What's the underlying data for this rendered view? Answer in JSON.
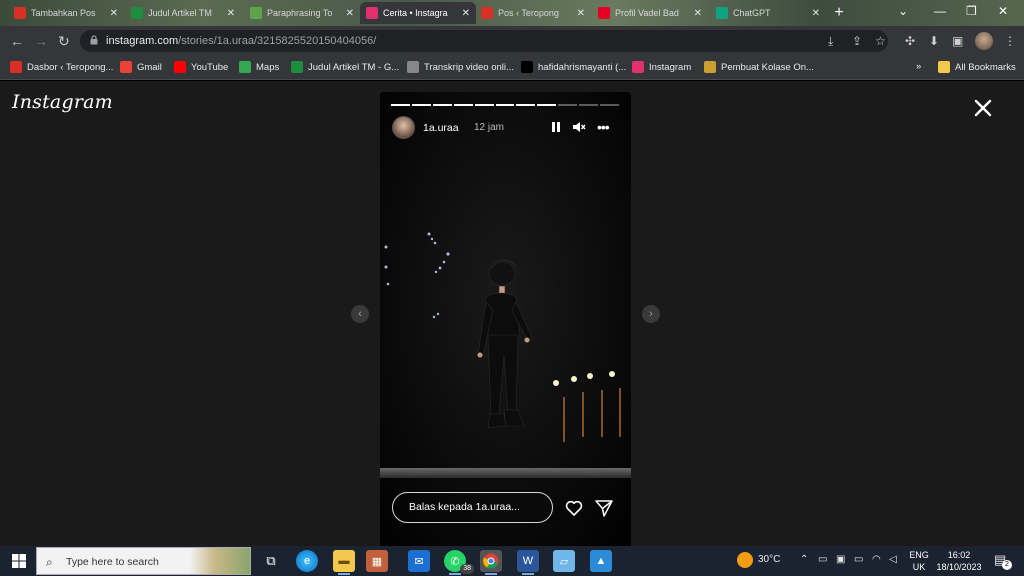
{
  "browser": {
    "tabs": [
      {
        "title": "Tambahkan Pos",
        "favicon": "blogger-m-icon",
        "color": "#d93025"
      },
      {
        "title": "Judul Artikel TM",
        "favicon": "sheets-plus-icon",
        "color": "#1e8e3e"
      },
      {
        "title": "Paraphrasing To",
        "favicon": "quillbot-icon",
        "color": "#5ba44a"
      },
      {
        "title": "Cerita • Instagra",
        "favicon": "instagram-icon",
        "color": "#e1306c",
        "active": true
      },
      {
        "title": "Pos ‹ Teropong",
        "favicon": "blogger-m-icon",
        "color": "#d93025"
      },
      {
        "title": "Profil Vadel Bad",
        "favicon": "pinterest-icon",
        "color": "#e60023"
      },
      {
        "title": "ChatGPT",
        "favicon": "chatgpt-icon",
        "color": "#10a37f"
      }
    ],
    "new_tab_label": "+",
    "url_domain": "instagram.com",
    "url_path": "/stories/1a.uraa/3215825520150404056/",
    "bookmarks": [
      {
        "label": "Dasbor ‹ Teropong...",
        "favicon": "blogger-m-icon",
        "color": "#d93025"
      },
      {
        "label": "Gmail",
        "favicon": "gmail-icon",
        "color": "#ea4335"
      },
      {
        "label": "YouTube",
        "favicon": "youtube-icon",
        "color": "#ff0000"
      },
      {
        "label": "Maps",
        "favicon": "maps-pin-icon",
        "color": "#34a853"
      },
      {
        "label": "Judul Artikel TM - G...",
        "favicon": "sheets-plus-icon",
        "color": "#1e8e3e"
      },
      {
        "label": "Transkrip video onli...",
        "favicon": "gear-icon",
        "color": "#888888"
      },
      {
        "label": "hafidahrismayanti (...",
        "favicon": "tiktok-icon",
        "color": "#000000"
      },
      {
        "label": "Instagram",
        "favicon": "instagram-icon",
        "color": "#e1306c"
      },
      {
        "label": "Pembuat Kolase On...",
        "favicon": "collage-icon",
        "color": "#c8a030"
      }
    ],
    "bookmarks_overflow": "»",
    "all_bookmarks_label": "All Bookmarks"
  },
  "page": {
    "logo_text": "Instagram",
    "story": {
      "username": "1a.uraa",
      "time_ago": "12 jam",
      "segments_total": 11,
      "segments_done": 8,
      "reply_placeholder": "Balas kepada 1a.uraa..."
    }
  },
  "taskbar": {
    "search_placeholder": "Type here to search",
    "whatsapp_badge": "38",
    "weather_temp": "30°C",
    "lang_line1": "ENG",
    "lang_line2": "UK",
    "time": "16:02",
    "date": "18/10/2023",
    "notification_count": "2"
  }
}
